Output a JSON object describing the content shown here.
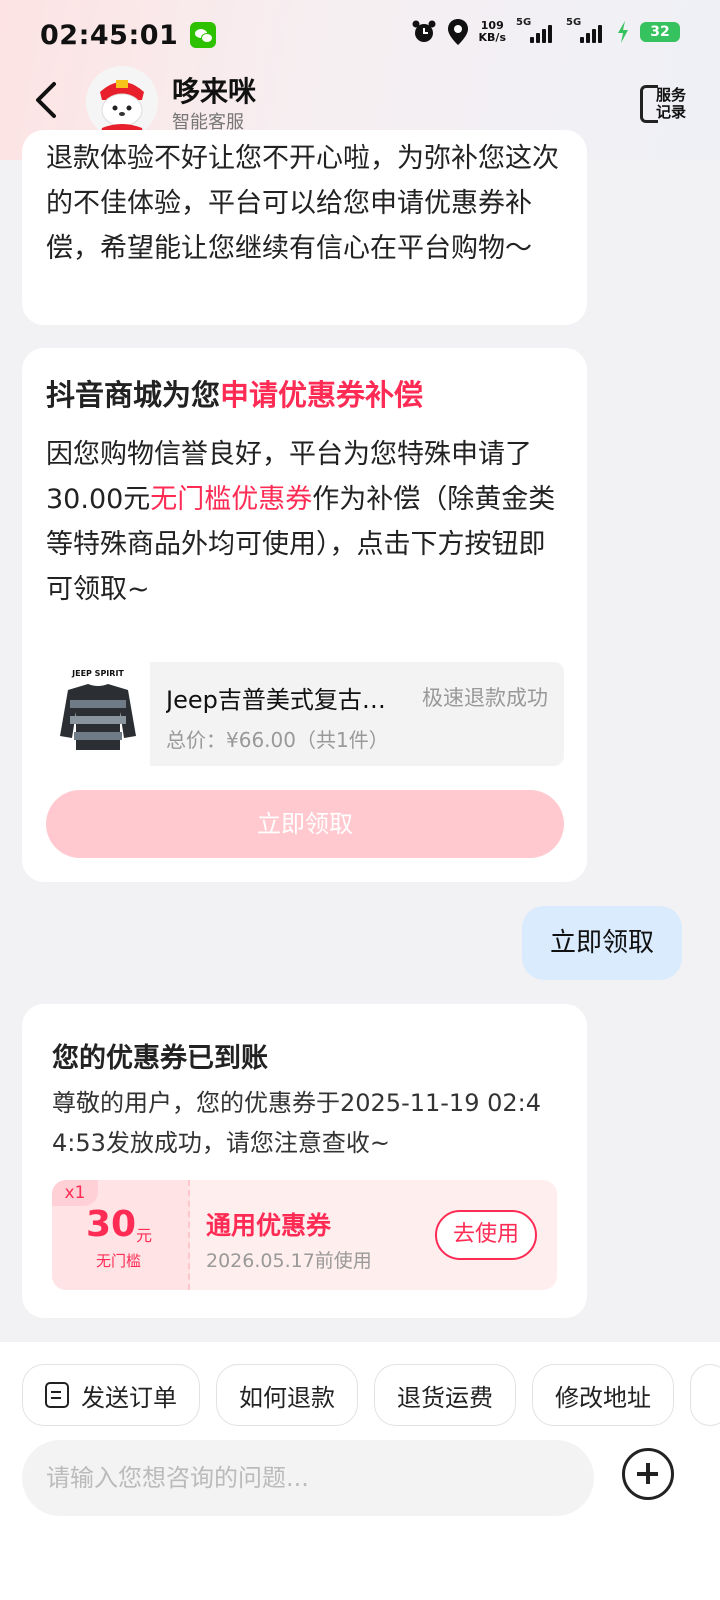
{
  "status_bar": {
    "time": "02:45:01",
    "net_speed_value": "109",
    "net_speed_unit": "KB/s",
    "sig1_label": "5G",
    "sig2_label": "5G",
    "battery": "32"
  },
  "header": {
    "title": "哆来咪",
    "subtitle": "智能客服",
    "service_label_1": "服务",
    "service_label_2": "记录"
  },
  "messages": {
    "bot_1_text": "退款体验不好让您不开心啦，为弥补您这次的不佳体验，平台可以给您申请优惠券补偿，希望能让您继续有信心在平台购物～",
    "bot_2": {
      "title_prefix": "抖音商城为您",
      "title_highlight": "申请优惠券补偿",
      "body_1": "因您购物信誉良好，平台为您特殊申请了30.00元",
      "body_highlight": "无门槛优惠券",
      "body_2": "作为补偿（除黄金类等特殊商品外均可使用），点击下方按钮即可领取~",
      "order": {
        "thumb_brand": "JEEP SPIRIT",
        "product_name": "Jeep吉普美式复古条纹毛衣",
        "status": "极速退款成功",
        "price": "总价：¥66.00（共1件）"
      },
      "button_label": "立即领取"
    },
    "user_1_text": "立即领取",
    "bot_3": {
      "title": "您的优惠券已到账",
      "body": "尊敬的用户，您的优惠券于2025-11-19 02:44:53发放成功，请您注意查收~",
      "coupon": {
        "count": "x1",
        "amount": "30",
        "unit": "元",
        "condition": "无门槛",
        "name": "通用优惠券",
        "expiry": "2026.05.17前使用",
        "use_label": "去使用"
      }
    }
  },
  "bottom": {
    "chips": [
      "发送订单",
      "如何退款",
      "退货运费",
      "修改地址"
    ],
    "input_placeholder": "请输入您想咨询的问题..."
  },
  "colors": {
    "accent": "#fe2c55",
    "user_bubble": "#d9ebfc",
    "claim_button_disabled": "#ffc9cf"
  }
}
